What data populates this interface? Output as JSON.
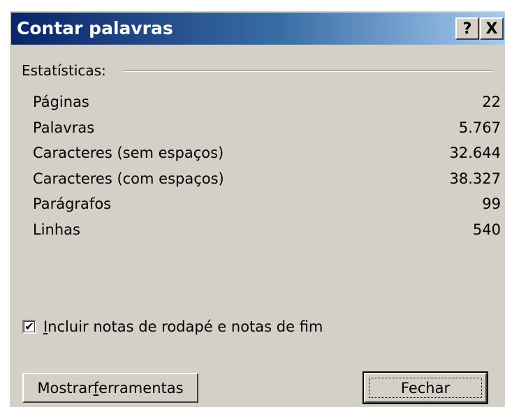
{
  "window": {
    "title": "Contar palavras",
    "help_label": "?",
    "close_label": "X"
  },
  "group": {
    "label": "Estatísticas:"
  },
  "stats": [
    {
      "label": "Páginas",
      "value": "22"
    },
    {
      "label": "Palavras",
      "value": "5.767"
    },
    {
      "label": "Caracteres (sem espaços)",
      "value": "32.644"
    },
    {
      "label": "Caracteres (com espaços)",
      "value": "38.327"
    },
    {
      "label": "Parágrafos",
      "value": "99"
    },
    {
      "label": "Linhas",
      "value": "540"
    }
  ],
  "checkbox": {
    "checked": true,
    "mark": "✔",
    "label_hotkey": "I",
    "label_rest": "ncluir notas de rodapé e notas de fim"
  },
  "buttons": {
    "tools_pre": "Mostrar ",
    "tools_hotkey": "f",
    "tools_post": "erramentas",
    "close_label": "Fechar"
  },
  "colors": {
    "dialog_bg": "#d4d0c8",
    "title_start": "#0a246a",
    "title_end": "#a6caf0"
  }
}
